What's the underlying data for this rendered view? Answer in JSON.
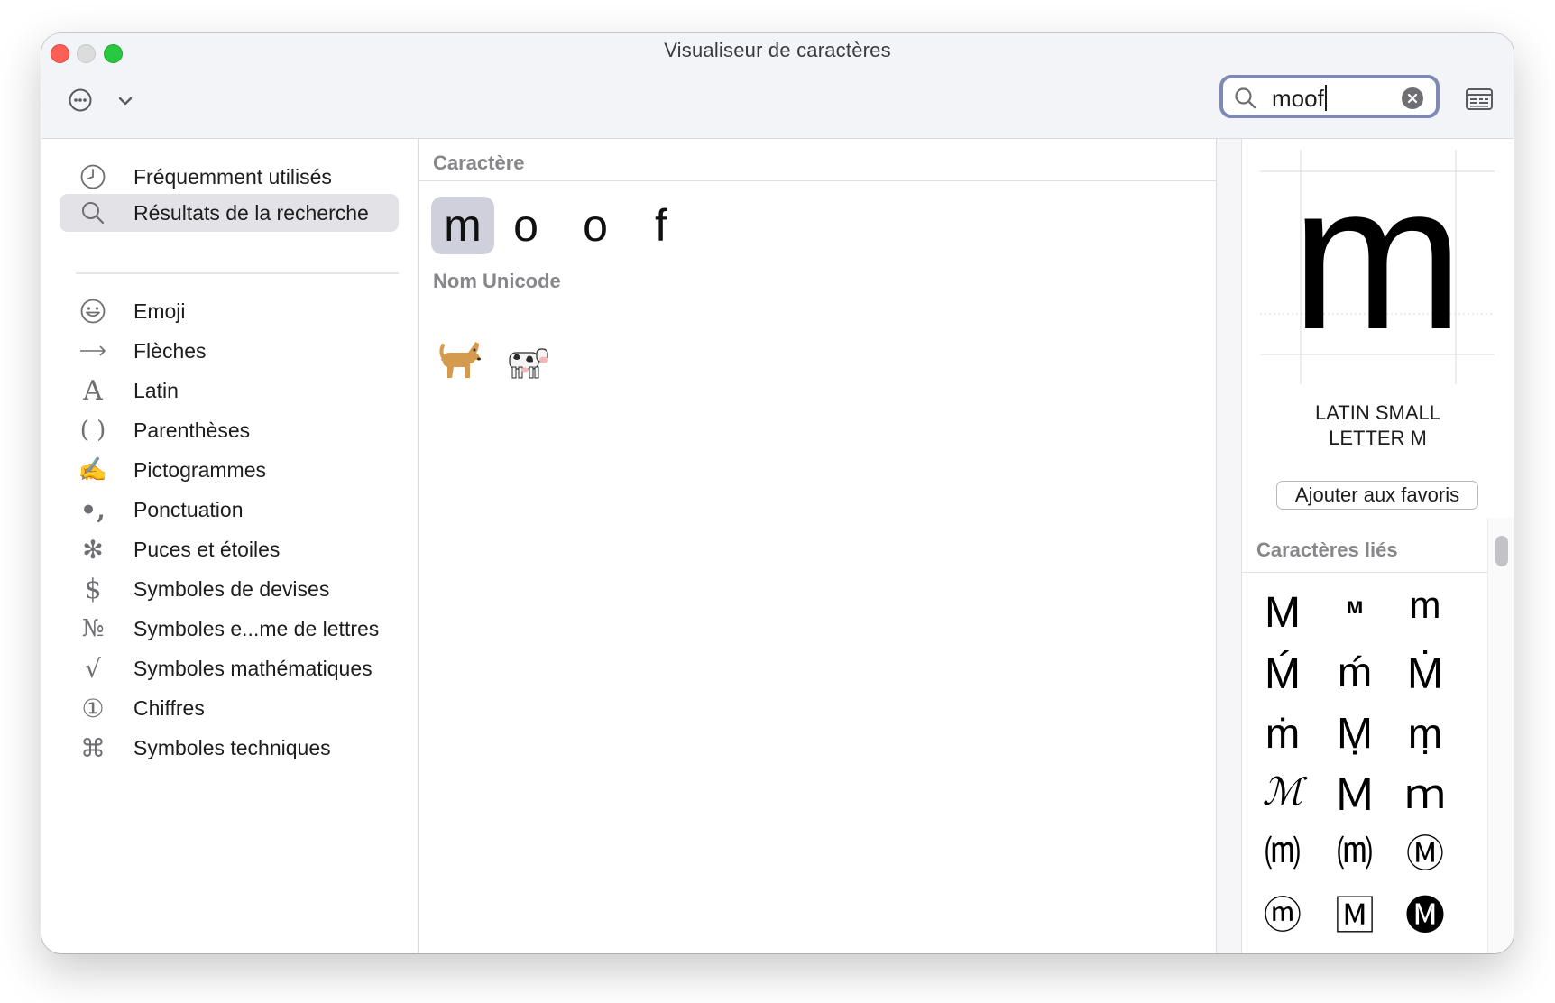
{
  "window": {
    "title": "Visualiseur de caractères"
  },
  "toolbar": {
    "more_icon": "ellipsis-circle-icon",
    "chevron_icon": "chevron-down-icon",
    "search_value": "moof",
    "search_icon": "magnifier-icon",
    "clear_icon": "clear-circle-icon",
    "keyboard_icon": "keyboard-viewer-icon"
  },
  "sidebar": {
    "items": [
      {
        "label": "Fréquemment utilisés",
        "icon": "clock-icon"
      },
      {
        "label": "Résultats de la recherche",
        "icon": "magnifier-icon",
        "selected": true
      },
      {
        "label": "Emoji",
        "icon": "smiley-icon"
      },
      {
        "label": "Flèches",
        "icon": "arrow-icon"
      },
      {
        "label": "Latin",
        "icon": "latin-a-icon"
      },
      {
        "label": "Parenthèses",
        "icon": "parentheses-icon"
      },
      {
        "label": "Pictogrammes",
        "icon": "writing-hand-icon"
      },
      {
        "label": "Ponctuation",
        "icon": "punctuation-icon"
      },
      {
        "label": "Puces et étoiles",
        "icon": "asterisk-icon"
      },
      {
        "label": "Symboles de devises",
        "icon": "dollar-icon"
      },
      {
        "label": "Symboles e...me de lettres",
        "icon": "numero-icon"
      },
      {
        "label": "Symboles mathématiques",
        "icon": "square-root-icon"
      },
      {
        "label": "Chiffres",
        "icon": "circled-one-icon"
      },
      {
        "label": "Symboles techniques",
        "icon": "command-icon"
      }
    ]
  },
  "main": {
    "character_header": "Caractère",
    "characters": [
      "m",
      "o",
      "o",
      "f"
    ],
    "selected_index": 0,
    "unicode_name_header": "Nom Unicode",
    "unicode_results": [
      {
        "glyph": "🐕",
        "icon": "dog-emoji-icon"
      },
      {
        "glyph": "🐄",
        "icon": "cow-emoji-icon"
      }
    ]
  },
  "inspector": {
    "glyph": "m",
    "name_line1": "LATIN SMALL",
    "name_line2": "LETTER M",
    "add_favorite": "Ajouter aux favoris",
    "related_header": "Caractères liés",
    "related": [
      "M",
      "ᴍ",
      "m",
      "Ḿ",
      "ḿ",
      "Ṁ",
      "ṁ",
      "Ṃ",
      "ṃ",
      "ℳ",
      "Ｍ",
      "ｍ",
      "⒨",
      "⒨",
      "Ⓜ",
      "ⓜ",
      "🄼",
      "🅜"
    ]
  }
}
